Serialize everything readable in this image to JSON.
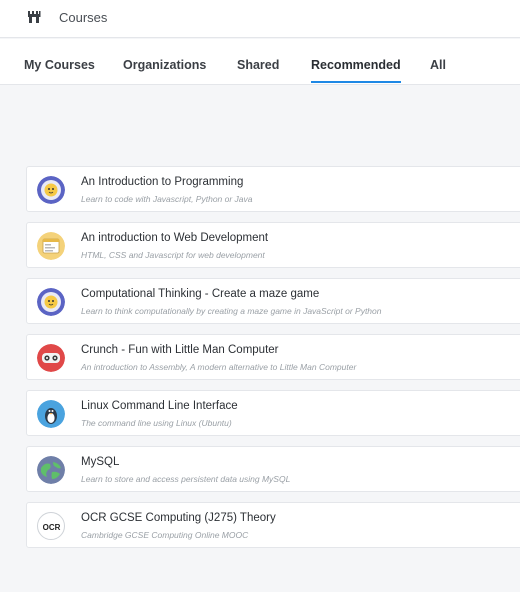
{
  "header": {
    "title": "Courses",
    "logo_icon": "castle-icon"
  },
  "tabs": [
    {
      "label": "My Courses",
      "active": false
    },
    {
      "label": "Organizations",
      "active": false
    },
    {
      "label": "Shared",
      "active": false
    },
    {
      "label": "Recommended",
      "active": true
    },
    {
      "label": "All",
      "active": false
    }
  ],
  "accent_color": "#1e88e5",
  "courses": [
    {
      "title": "An Introduction to Programming",
      "subtitle": "Learn to code with Javascript, Python or Java",
      "icon": "astronaut-icon"
    },
    {
      "title": "An introduction to Web Development",
      "subtitle": "HTML, CSS and Javascript for web development",
      "icon": "web-browser-icon"
    },
    {
      "title": "Computational Thinking - Create a maze game",
      "subtitle": "Learn to think computationally by creating a maze game in JavaScript or Python",
      "icon": "astronaut-icon"
    },
    {
      "title": "Crunch - Fun with Little Man Computer",
      "subtitle": "An introduction to Assembly, A modern alternative to Little Man Computer",
      "icon": "robot-icon"
    },
    {
      "title": "Linux Command Line Interface",
      "subtitle": "The command line using Linux (Ubuntu)",
      "icon": "penguin-icon"
    },
    {
      "title": "MySQL",
      "subtitle": "Learn to store and access persistent data using MySQL",
      "icon": "globe-icon"
    },
    {
      "title": "OCR GCSE Computing (J275) Theory",
      "subtitle": "Cambridge GCSE Computing Online MOOC",
      "icon": "ocr-logo-icon",
      "icon_text": "OCR"
    }
  ]
}
